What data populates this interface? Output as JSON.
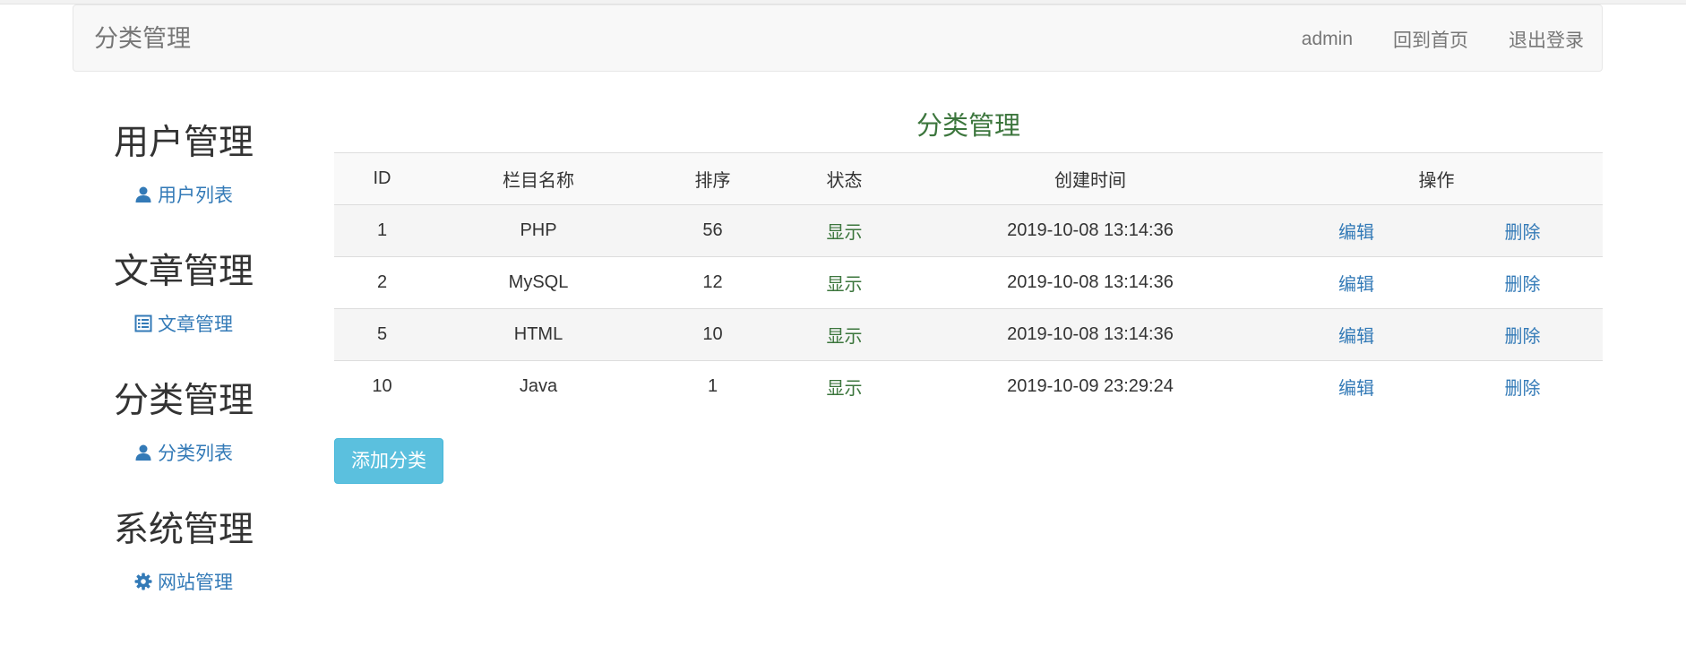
{
  "navbar": {
    "brand": "分类管理",
    "user": "admin",
    "home": "回到首页",
    "logout": "退出登录"
  },
  "sidebar": {
    "groups": [
      {
        "title": "用户管理",
        "link": "用户列表",
        "icon": "user-icon"
      },
      {
        "title": "文章管理",
        "link": "文章管理",
        "icon": "list-icon"
      },
      {
        "title": "分类管理",
        "link": "分类列表",
        "icon": "user-icon"
      },
      {
        "title": "系统管理",
        "link": "网站管理",
        "icon": "gear-icon"
      }
    ]
  },
  "main": {
    "title": "分类管理",
    "headers": [
      "ID",
      "栏目名称",
      "排序",
      "状态",
      "创建时间",
      "操作"
    ],
    "rows": [
      {
        "id": "1",
        "name": "PHP",
        "order": "56",
        "status": "显示",
        "created": "2019-10-08 13:14:36",
        "edit": "编辑",
        "delete": "删除"
      },
      {
        "id": "2",
        "name": "MySQL",
        "order": "12",
        "status": "显示",
        "created": "2019-10-08 13:14:36",
        "edit": "编辑",
        "delete": "删除"
      },
      {
        "id": "5",
        "name": "HTML",
        "order": "10",
        "status": "显示",
        "created": "2019-10-08 13:14:36",
        "edit": "编辑",
        "delete": "删除"
      },
      {
        "id": "10",
        "name": "Java",
        "order": "1",
        "status": "显示",
        "created": "2019-10-09 23:29:24",
        "edit": "编辑",
        "delete": "删除"
      }
    ],
    "add_button": "添加分类"
  },
  "colors": {
    "link": "#337ab7",
    "status": "#3c763d",
    "button": "#5bc0de"
  }
}
